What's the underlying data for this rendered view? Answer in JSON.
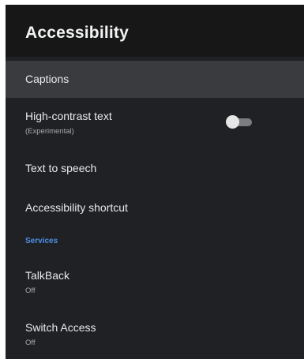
{
  "header": {
    "title": "Accessibility"
  },
  "items": {
    "captions": {
      "label": "Captions"
    },
    "high_contrast": {
      "label": "High-contrast text",
      "sub": "(Experimental)",
      "toggle_on": false
    },
    "tts": {
      "label": "Text to speech"
    },
    "shortcut": {
      "label": "Accessibility shortcut"
    }
  },
  "services": {
    "header": "Services",
    "talkback": {
      "label": "TalkBack",
      "status": "Off"
    },
    "switch_access": {
      "label": "Switch Access",
      "status": "Off"
    }
  },
  "colors": {
    "background": "#202124",
    "header_bg": "#171717",
    "selected_row": "#3a3b3e",
    "section_accent": "#4b8fe6"
  }
}
